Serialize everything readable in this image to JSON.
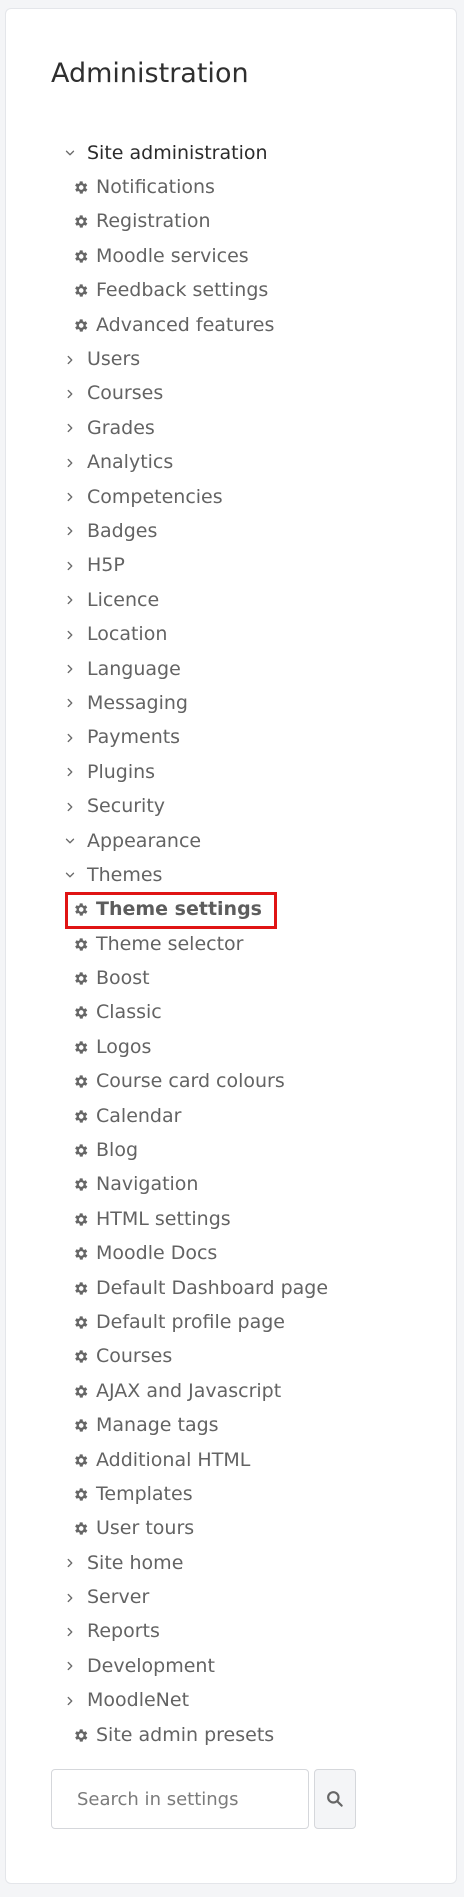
{
  "panel": {
    "title": "Administration"
  },
  "tree": {
    "items": [
      {
        "label": "Site administration",
        "level": 0,
        "type": "branch",
        "expanded": true
      },
      {
        "label": "Notifications",
        "level": 1,
        "type": "leaf"
      },
      {
        "label": "Registration",
        "level": 1,
        "type": "leaf"
      },
      {
        "label": "Moodle services",
        "level": 1,
        "type": "leaf"
      },
      {
        "label": "Feedback settings",
        "level": 1,
        "type": "leaf"
      },
      {
        "label": "Advanced features",
        "level": 1,
        "type": "leaf"
      },
      {
        "label": "Users",
        "level": 0,
        "type": "branch",
        "expanded": false
      },
      {
        "label": "Courses",
        "level": 0,
        "type": "branch",
        "expanded": false
      },
      {
        "label": "Grades",
        "level": 0,
        "type": "branch",
        "expanded": false
      },
      {
        "label": "Analytics",
        "level": 0,
        "type": "branch",
        "expanded": false
      },
      {
        "label": "Competencies",
        "level": 0,
        "type": "branch",
        "expanded": false
      },
      {
        "label": "Badges",
        "level": 0,
        "type": "branch",
        "expanded": false
      },
      {
        "label": "H5P",
        "level": 0,
        "type": "branch",
        "expanded": false
      },
      {
        "label": "Licence",
        "level": 0,
        "type": "branch",
        "expanded": false
      },
      {
        "label": "Location",
        "level": 0,
        "type": "branch",
        "expanded": false
      },
      {
        "label": "Language",
        "level": 0,
        "type": "branch",
        "expanded": false
      },
      {
        "label": "Messaging",
        "level": 0,
        "type": "branch",
        "expanded": false
      },
      {
        "label": "Payments",
        "level": 0,
        "type": "branch",
        "expanded": false
      },
      {
        "label": "Plugins",
        "level": 0,
        "type": "branch",
        "expanded": false
      },
      {
        "label": "Security",
        "level": 0,
        "type": "branch",
        "expanded": false
      },
      {
        "label": "Appearance",
        "level": 0,
        "type": "branch",
        "expanded": true
      },
      {
        "label": "Themes",
        "level": 0,
        "type": "branch",
        "expanded": true
      },
      {
        "label": "Theme settings",
        "level": 1,
        "type": "leaf",
        "highlighted": true
      },
      {
        "label": "Theme selector",
        "level": 1,
        "type": "leaf"
      },
      {
        "label": "Boost",
        "level": 1,
        "type": "leaf"
      },
      {
        "label": "Classic",
        "level": 1,
        "type": "leaf"
      },
      {
        "label": "Logos",
        "level": 1,
        "type": "leaf"
      },
      {
        "label": "Course card colours",
        "level": 1,
        "type": "leaf"
      },
      {
        "label": "Calendar",
        "level": 1,
        "type": "leaf"
      },
      {
        "label": "Blog",
        "level": 1,
        "type": "leaf"
      },
      {
        "label": "Navigation",
        "level": 1,
        "type": "leaf"
      },
      {
        "label": "HTML settings",
        "level": 1,
        "type": "leaf"
      },
      {
        "label": "Moodle Docs",
        "level": 1,
        "type": "leaf"
      },
      {
        "label": "Default Dashboard page",
        "level": 1,
        "type": "leaf"
      },
      {
        "label": "Default profile page",
        "level": 1,
        "type": "leaf"
      },
      {
        "label": "Courses",
        "level": 1,
        "type": "leaf"
      },
      {
        "label": "AJAX and Javascript",
        "level": 1,
        "type": "leaf"
      },
      {
        "label": "Manage tags",
        "level": 1,
        "type": "leaf"
      },
      {
        "label": "Additional HTML",
        "level": 1,
        "type": "leaf"
      },
      {
        "label": "Templates",
        "level": 1,
        "type": "leaf"
      },
      {
        "label": "User tours",
        "level": 1,
        "type": "leaf"
      },
      {
        "label": "Site home",
        "level": 0,
        "type": "branch",
        "expanded": false
      },
      {
        "label": "Server",
        "level": 0,
        "type": "branch",
        "expanded": false
      },
      {
        "label": "Reports",
        "level": 0,
        "type": "branch",
        "expanded": false
      },
      {
        "label": "Development",
        "level": 0,
        "type": "branch",
        "expanded": false
      },
      {
        "label": "MoodleNet",
        "level": 0,
        "type": "branch",
        "expanded": false
      },
      {
        "label": "Site admin presets",
        "level": 1,
        "type": "leaf"
      }
    ]
  },
  "search": {
    "placeholder": "Search in settings",
    "icon": "search-icon"
  },
  "colors": {
    "highlight_border": "#e01414"
  }
}
